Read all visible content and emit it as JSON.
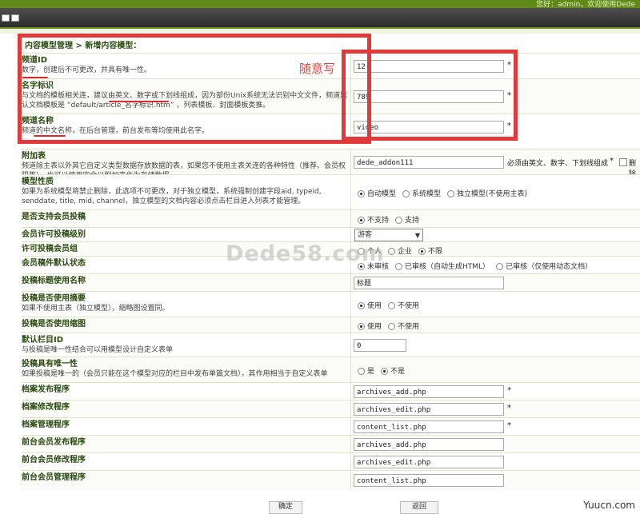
{
  "header": {
    "user_text": "您好：admin，欢迎使用Dede"
  },
  "breadcrumb": "内容模型管理 > 新增内容模型：",
  "annotation": "随意写",
  "watermark": "Dede58.com",
  "site_mark": "Yuucn.com",
  "rows": [
    {
      "title": "频道ID",
      "desc": "数字，创建后不可更改，并具有唯一性。",
      "value": "12",
      "required": "*"
    },
    {
      "title": "名字标识",
      "desc": "与文档的模板相关连，建议由英文、数字或下划线组成，因为部份Unix系统无法识别中文文件，频道默认文档模板是 “default/article_名字标识.htm” ，列表模板、封面模板类推。",
      "value": "789",
      "required": "*"
    },
    {
      "title": "频道名称",
      "desc": "频道的中文名称，在后台管理，前台发布等均使用此名字。",
      "value": "video",
      "required": "*"
    },
    {
      "title": "附加表",
      "desc": "频道除主表以外其它自定义类型数据存放数据的表，如果您不使用主表关连的各种特性（推荐、会员权限等），也可以使用完全以附加表作为存储数据。",
      "value": "dede_addon111",
      "hint": "必须由英文、数字、下划线组成",
      "required": "*",
      "checkbox_label": "删除"
    },
    {
      "title": "模型性质",
      "desc": "如果为系统模型将禁止删除，此选项不可更改，对于独立模型，系统强制创建字段aid, typeid, senddate, title, mid, channel，独立模型的文档内容必须点击栏目进入列表才能管理。",
      "options": [
        "自动模型",
        "系统模型",
        "独立模型(不使用主表)"
      ],
      "selected": 0
    },
    {
      "title": "是否支持会员投稿",
      "options": [
        "不支持",
        "支持"
      ],
      "selected": 0
    },
    {
      "title": "会员许可投稿级别",
      "select": "游客"
    },
    {
      "title": "许可投稿会员组",
      "options": [
        "个人",
        "企业",
        "不限"
      ],
      "selected": 2
    },
    {
      "title": "会员稿件默认状态",
      "options": [
        "未审核",
        "已审核（自动生成HTML）",
        "已审核（仅使用动态文档）"
      ],
      "selected": 0
    },
    {
      "title": "投稿标题使用名称",
      "value": "标题"
    },
    {
      "title": "投稿是否使用摘要",
      "desc": "如果不使用主表（独立模型），缩略图设置同。",
      "options": [
        "使用",
        "不使用"
      ],
      "selected": 0
    },
    {
      "title": "投稿是否使用缩图",
      "options": [
        "使用",
        "不使用"
      ],
      "selected": 0
    },
    {
      "title": "默认栏目ID",
      "desc": "与投稿是唯一性结合可以用模型设计自定义表单",
      "value": "0"
    },
    {
      "title": "投稿具有唯一性",
      "desc": "如果投稿是唯一的（会员只能在这个模型对应的栏目中发布单篇文档），其作用相当于自定义表单",
      "options": [
        "是",
        "不是"
      ],
      "selected": 1
    },
    {
      "title": "档案发布程序",
      "value": "archives_add.php",
      "required": "*"
    },
    {
      "title": "档案修改程序",
      "value": "archives_edit.php",
      "required": "*"
    },
    {
      "title": "档案管理程序",
      "value": "content_list.php",
      "required": "*"
    },
    {
      "title": "前台会员发布程序",
      "value": "archives_add.php"
    },
    {
      "title": "前台会员修改程序",
      "value": "archives_edit.php"
    },
    {
      "title": "前台会员管理程序",
      "value": "content_list.php"
    }
  ],
  "buttons": {
    "ok": "确定",
    "back": "返回"
  }
}
